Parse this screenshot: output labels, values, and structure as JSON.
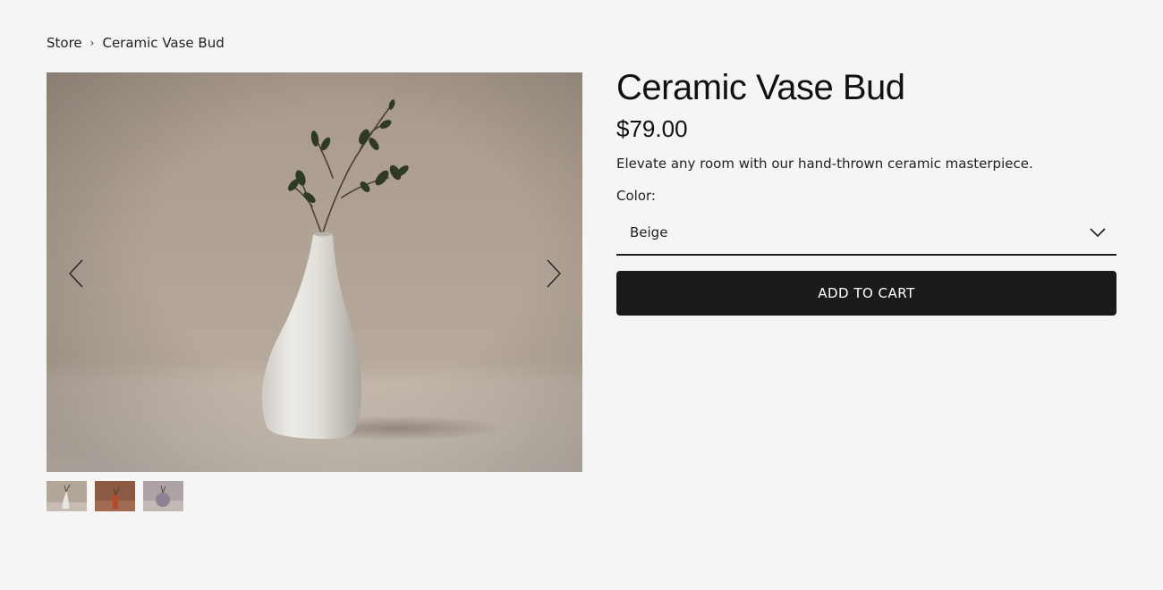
{
  "breadcrumb": {
    "store": "Store",
    "separator": "›",
    "current": "Ceramic Vase Bud"
  },
  "gallery": {
    "prev_icon": "chevron-left-icon",
    "next_icon": "chevron-right-icon",
    "thumbnail_count": 3
  },
  "product": {
    "title": "Ceramic Vase Bud",
    "price": "$79.00",
    "description": "Elevate any room with our hand-thrown ceramic masterpiece.",
    "color_label": "Color:",
    "color_selected": "Beige",
    "add_to_cart": "ADD TO CART"
  },
  "colors": {
    "background": "#f5f5f5",
    "button": "#1b1b1b",
    "text": "#1d1d1d"
  }
}
